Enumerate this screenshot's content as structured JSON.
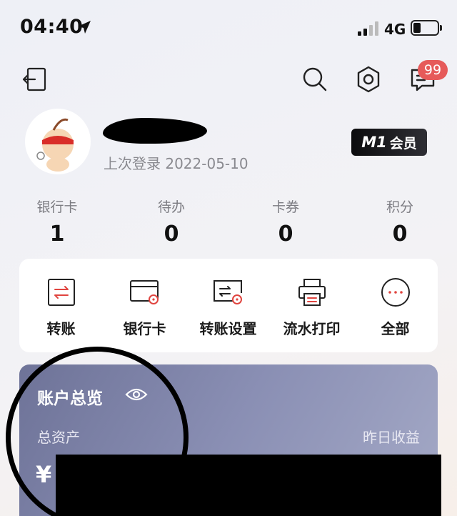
{
  "status_bar": {
    "time": "04:40",
    "network": "4G",
    "battery_level": 0.3
  },
  "top_nav": {
    "notification_count": "99"
  },
  "profile": {
    "last_login": "上次登录 2022-05-10",
    "member_level": "M1",
    "member_label": "会员"
  },
  "stats": [
    {
      "label": "银行卡",
      "value": "1"
    },
    {
      "label": "待办",
      "value": "0"
    },
    {
      "label": "卡券",
      "value": "0"
    },
    {
      "label": "积分",
      "value": "0"
    }
  ],
  "quick_actions": [
    {
      "label": "转账",
      "icon": "transfer-icon"
    },
    {
      "label": "银行卡",
      "icon": "bank-card-icon"
    },
    {
      "label": "转账设置",
      "icon": "transfer-settings-icon"
    },
    {
      "label": "流水打印",
      "icon": "printer-icon"
    },
    {
      "label": "全部",
      "icon": "more-icon"
    }
  ],
  "asset_card": {
    "title": "账户总览",
    "total_label": "总资产",
    "yesterday_label": "昨日收益",
    "currency": "¥"
  },
  "colors": {
    "accent": "#e0443f",
    "badge": "#e65a5a",
    "card_gradient_start": "#6e7398",
    "card_gradient_end": "#a4a9c6"
  }
}
